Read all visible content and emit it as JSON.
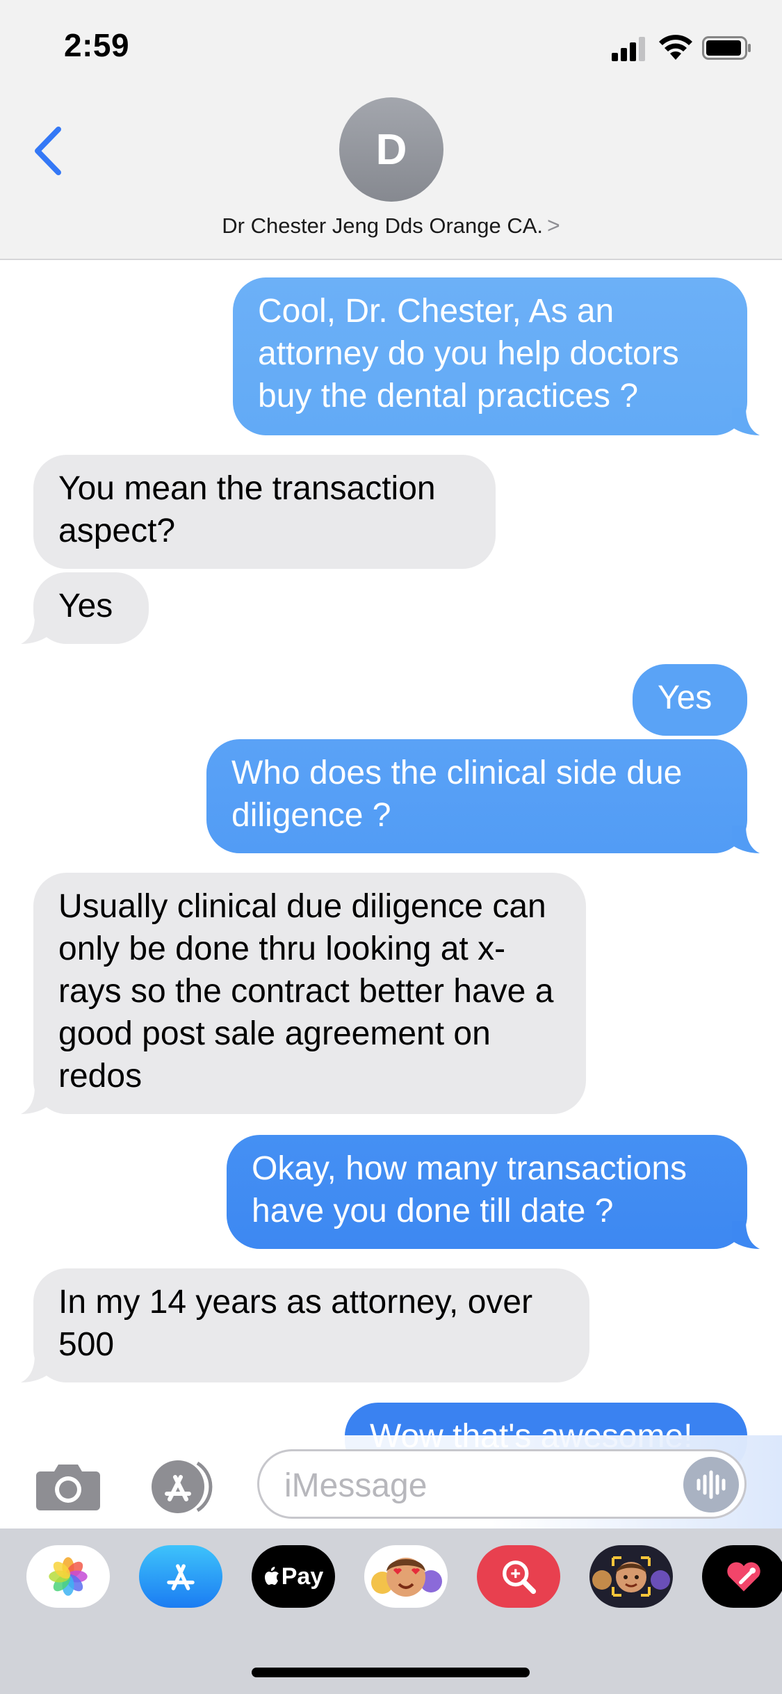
{
  "status": {
    "time": "2:59"
  },
  "contact": {
    "initial": "D",
    "name": "Dr Chester Jeng Dds Orange CA.",
    "chevron": ">"
  },
  "messages": [
    {
      "direction": "out",
      "text": "Cool, Dr. Chester,  As an attorney do you help doctors buy the dental practices ?"
    },
    {
      "direction": "in",
      "text": "You mean the transaction aspect?"
    },
    {
      "direction": "in",
      "text": "Yes"
    },
    {
      "direction": "out",
      "text": "Yes"
    },
    {
      "direction": "out",
      "text": "Who does the clinical side due diligence ?"
    },
    {
      "direction": "in",
      "text": "Usually clinical due diligence can only be done thru looking at x-rays so the contract better have a good post sale agreement on redos"
    },
    {
      "direction": "out",
      "text": "Okay, how many transactions have you done till date ?"
    },
    {
      "direction": "in",
      "text": "In my 14 years as attorney, over 500"
    },
    {
      "direction": "out",
      "text": "Wow that's awesome!"
    }
  ],
  "input": {
    "placeholder": "iMessage"
  },
  "app_drawer": [
    {
      "icon": "photos-icon"
    },
    {
      "icon": "app-store-icon"
    },
    {
      "icon": "apple-pay-icon",
      "label": "Pay"
    },
    {
      "icon": "memoji-stickers-icon"
    },
    {
      "icon": "image-search-icon"
    },
    {
      "icon": "memoji-icon"
    },
    {
      "icon": "digital-touch-icon"
    }
  ],
  "colors": {
    "accent": "#3478f6",
    "outgoing_top": "#6fb1f7",
    "outgoing_bottom": "#3a82f1",
    "incoming": "#e9e9eb"
  }
}
